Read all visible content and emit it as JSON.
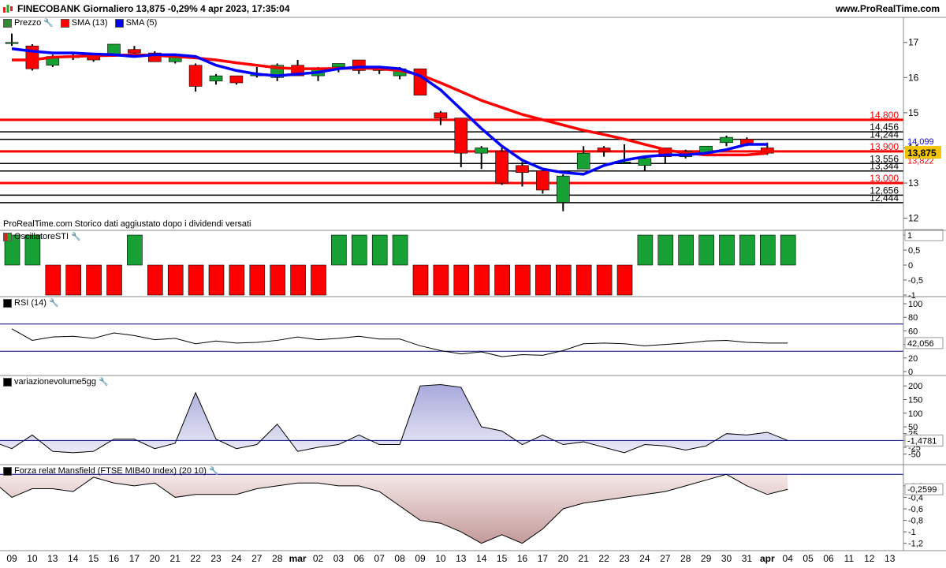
{
  "header": {
    "title": "FINECOBANK Giornaliero 13,875 -0,29% 4 apr 2023, 17:35:04",
    "brand": "www.ProRealTime.com"
  },
  "note": "ProRealTime.com Storico dati aggiustato dopo i dividendi versati",
  "legend_main": [
    {
      "label": "Prezzo",
      "color": "#2e8b2e"
    },
    {
      "label": "SMA (13)",
      "color": "#ff0000"
    },
    {
      "label": "SMA (5)",
      "color": "#0000ff"
    }
  ],
  "panels": {
    "osc": "OscillatoreSTI",
    "rsi": "RSI (14)",
    "vol": "variazionevolume5gg",
    "mans": "Forza relat Mansfield (FTSE MIB40 Index) (20 10)"
  },
  "colors": {
    "up": "#17a033",
    "down": "#ff0000",
    "sma13": "#ff0000",
    "sma5": "#0000ff",
    "badge": "#f5c400"
  },
  "chart_data": [
    {
      "type": "candlestick",
      "title": "FINECOBANK Giornaliero",
      "x_labels": [
        "09",
        "10",
        "13",
        "14",
        "15",
        "16",
        "17",
        "20",
        "21",
        "22",
        "23",
        "24",
        "27",
        "28",
        "mar",
        "02",
        "03",
        "06",
        "07",
        "08",
        "09",
        "10",
        "13",
        "14",
        "15",
        "16",
        "17",
        "20",
        "21",
        "22",
        "23",
        "24",
        "27",
        "28",
        "29",
        "30",
        "31",
        "apr",
        "04",
        "05",
        "06",
        "11",
        "12",
        "13"
      ],
      "ylim": [
        11.7,
        17.6
      ],
      "y_ticks": [
        12,
        13,
        14,
        15,
        16,
        17
      ],
      "candles": [
        {
          "o": 17.0,
          "h": 17.25,
          "l": 16.9,
          "c": 17.0
        },
        {
          "o": 16.9,
          "h": 16.95,
          "l": 16.2,
          "c": 16.25
        },
        {
          "o": 16.35,
          "h": 16.65,
          "l": 16.3,
          "c": 16.6
        },
        {
          "o": 16.6,
          "h": 16.7,
          "l": 16.5,
          "c": 16.6
        },
        {
          "o": 16.6,
          "h": 16.7,
          "l": 16.45,
          "c": 16.5
        },
        {
          "o": 16.65,
          "h": 16.95,
          "l": 16.6,
          "c": 16.95
        },
        {
          "o": 16.8,
          "h": 16.9,
          "l": 16.6,
          "c": 16.7
        },
        {
          "o": 16.7,
          "h": 16.75,
          "l": 16.45,
          "c": 16.45
        },
        {
          "o": 16.45,
          "h": 16.65,
          "l": 16.4,
          "c": 16.6
        },
        {
          "o": 16.35,
          "h": 16.4,
          "l": 15.6,
          "c": 15.75
        },
        {
          "o": 15.9,
          "h": 16.1,
          "l": 15.8,
          "c": 16.05
        },
        {
          "o": 16.05,
          "h": 16.05,
          "l": 15.8,
          "c": 15.85
        },
        {
          "o": 16.05,
          "h": 16.3,
          "l": 16.0,
          "c": 16.1
        },
        {
          "o": 16.0,
          "h": 16.4,
          "l": 15.9,
          "c": 16.35
        },
        {
          "o": 16.35,
          "h": 16.5,
          "l": 16.05,
          "c": 16.05
        },
        {
          "o": 16.05,
          "h": 16.3,
          "l": 15.9,
          "c": 16.25
        },
        {
          "o": 16.3,
          "h": 16.4,
          "l": 16.15,
          "c": 16.4
        },
        {
          "o": 16.5,
          "h": 16.5,
          "l": 16.1,
          "c": 16.2
        },
        {
          "o": 16.3,
          "h": 16.3,
          "l": 16.1,
          "c": 16.2
        },
        {
          "o": 16.05,
          "h": 16.3,
          "l": 15.95,
          "c": 16.25
        },
        {
          "o": 16.25,
          "h": 16.25,
          "l": 15.5,
          "c": 15.5
        },
        {
          "o": 15.0,
          "h": 15.05,
          "l": 14.65,
          "c": 14.85
        },
        {
          "o": 14.85,
          "h": 14.85,
          "l": 13.45,
          "c": 13.85
        },
        {
          "o": 13.85,
          "h": 14.05,
          "l": 13.4,
          "c": 14.0
        },
        {
          "o": 13.9,
          "h": 14.0,
          "l": 12.95,
          "c": 13.0
        },
        {
          "o": 13.5,
          "h": 13.6,
          "l": 12.9,
          "c": 13.3
        },
        {
          "o": 13.35,
          "h": 13.35,
          "l": 12.7,
          "c": 12.8
        },
        {
          "o": 12.45,
          "h": 13.25,
          "l": 12.2,
          "c": 13.2
        },
        {
          "o": 13.4,
          "h": 14.05,
          "l": 13.4,
          "c": 13.85
        },
        {
          "o": 14.0,
          "h": 14.05,
          "l": 13.75,
          "c": 13.9
        },
        {
          "o": 13.6,
          "h": 14.1,
          "l": 13.6,
          "c": 13.6
        },
        {
          "o": 13.5,
          "h": 13.75,
          "l": 13.35,
          "c": 13.7
        },
        {
          "o": 14.0,
          "h": 14.0,
          "l": 13.55,
          "c": 13.75
        },
        {
          "o": 13.75,
          "h": 13.95,
          "l": 13.7,
          "c": 13.9
        },
        {
          "o": 13.85,
          "h": 14.05,
          "l": 13.85,
          "c": 14.05
        },
        {
          "o": 14.15,
          "h": 14.35,
          "l": 14.05,
          "c": 14.3
        },
        {
          "o": 14.25,
          "h": 14.3,
          "l": 14.05,
          "c": 14.1
        },
        {
          "o": 14.0,
          "h": 14.15,
          "l": 13.8,
          "c": 13.85
        }
      ],
      "series": [
        {
          "name": "SMA (13)",
          "values": [
            16.5,
            16.5,
            16.58,
            16.6,
            16.62,
            16.63,
            16.65,
            16.63,
            16.6,
            16.56,
            16.5,
            16.42,
            16.35,
            16.28,
            16.25,
            16.25,
            16.26,
            16.27,
            16.25,
            16.2,
            16.08,
            15.85,
            15.6,
            15.35,
            15.15,
            14.95,
            14.8,
            14.65,
            14.5,
            14.38,
            14.25,
            14.1,
            13.95,
            13.85,
            13.8,
            13.8,
            13.8,
            13.85
          ]
        },
        {
          "name": "SMA (5)",
          "values": [
            16.82,
            16.75,
            16.7,
            16.7,
            16.67,
            16.65,
            16.6,
            16.65,
            16.65,
            16.6,
            16.35,
            16.2,
            16.1,
            16.05,
            16.1,
            16.15,
            16.25,
            16.3,
            16.3,
            16.25,
            16.05,
            15.65,
            15.1,
            14.55,
            14.05,
            13.65,
            13.4,
            13.3,
            13.25,
            13.5,
            13.65,
            13.75,
            13.8,
            13.8,
            13.85,
            13.95,
            14.1,
            14.1
          ]
        }
      ],
      "hlines": [
        {
          "value": 14.8,
          "label": "14,800",
          "color": "#ff0000"
        },
        {
          "value": 14.456,
          "label": "14,456",
          "color": "#000000"
        },
        {
          "value": 14.244,
          "label": "14,244",
          "color": "#000000"
        },
        {
          "value": 13.9,
          "label": "13,900",
          "color": "#ff0000"
        },
        {
          "value": 13.556,
          "label": "13,556",
          "color": "#000000"
        },
        {
          "value": 13.344,
          "label": "13,344",
          "color": "#000000"
        },
        {
          "value": 13.0,
          "label": "13,000",
          "color": "#ff0000"
        },
        {
          "value": 12.656,
          "label": "12,656",
          "color": "#000000"
        },
        {
          "value": 12.444,
          "label": "12,444",
          "color": "#000000"
        }
      ],
      "last_labels": [
        {
          "value": 14.099,
          "label": "14,099",
          "color": "#0000ff"
        },
        {
          "value": 13.822,
          "label": "13,822",
          "color": "#ff0000"
        },
        {
          "value": 13.875,
          "label": "13,875",
          "badge": true
        }
      ]
    },
    {
      "type": "bar",
      "title": "OscillatoreSTI",
      "ylim": [
        -1.2,
        1.2
      ],
      "y_ticks": [
        {
          "v": 1,
          "t": "1"
        },
        {
          "v": 0.5,
          "t": "0,5"
        },
        {
          "v": 0,
          "t": "0"
        },
        {
          "v": -0.5,
          "t": "-0,5"
        },
        {
          "v": -1,
          "t": "-1"
        }
      ],
      "values": [
        1,
        1,
        -1,
        -1,
        -1,
        -1,
        1,
        -1,
        -1,
        -1,
        -1,
        -1,
        -1,
        -1,
        -1,
        -1,
        1,
        1,
        1,
        1,
        -1,
        -1,
        -1,
        -1,
        -1,
        -1,
        -1,
        -1,
        -1,
        -1,
        -1,
        1,
        1,
        1,
        1,
        1,
        1,
        1,
        1
      ],
      "last_value_label": "1"
    },
    {
      "type": "line",
      "title": "RSI (14)",
      "ylim": [
        10,
        100
      ],
      "y_ticks": [
        {
          "v": 100,
          "t": "100"
        },
        {
          "v": 80,
          "t": "80"
        },
        {
          "v": 60,
          "t": "60"
        },
        {
          "v": 40,
          "t": "40"
        },
        {
          "v": 20,
          "t": "20"
        },
        {
          "v": 0,
          "t": "0"
        }
      ],
      "levels": [
        70,
        30
      ],
      "values": [
        63,
        46,
        51,
        52,
        49,
        57,
        53,
        47,
        49,
        41,
        45,
        42,
        43,
        46,
        51,
        47,
        49,
        52,
        48,
        48,
        38,
        31,
        26,
        29,
        22,
        25,
        24,
        31,
        41,
        42,
        41,
        38,
        40,
        42,
        45,
        46,
        43,
        42,
        42
      ],
      "last_value_label": "42,056"
    },
    {
      "type": "area",
      "title": "variazionevolume5gg",
      "ylim": [
        -80,
        215
      ],
      "y_ticks": [
        {
          "v": 200,
          "t": "200"
        },
        {
          "v": 150,
          "t": "150"
        },
        {
          "v": 100,
          "t": "100"
        },
        {
          "v": 50,
          "t": "50"
        },
        {
          "v": 25,
          "t": "25"
        },
        {
          "v": 0,
          "t": "0"
        },
        {
          "v": -25,
          "t": "-25"
        },
        {
          "v": -50,
          "t": "-50"
        }
      ],
      "values": [
        -2,
        -30,
        20,
        -40,
        -45,
        -40,
        5,
        5,
        -30,
        -10,
        175,
        5,
        -30,
        -15,
        60,
        -40,
        -25,
        -15,
        20,
        -15,
        -15,
        200,
        205,
        195,
        50,
        35,
        -15,
        20,
        -15,
        -5,
        -25,
        -45,
        -15,
        -20,
        -35,
        -20,
        25,
        20,
        30,
        0
      ],
      "last_value_label": "-1,4781"
    },
    {
      "type": "area",
      "title": "Forza relat Mansfield (FTSE MIB40 Index) (20 10)",
      "ylim": [
        -1.3,
        0.1
      ],
      "y_ticks": [
        {
          "v": -0.2,
          "t": "-0,2"
        },
        {
          "v": -0.4,
          "t": "-0,4"
        },
        {
          "v": -0.6,
          "t": "-0,6"
        },
        {
          "v": -0.8,
          "t": "-0,8"
        },
        {
          "v": -1,
          "t": "-1"
        },
        {
          "v": -1.2,
          "t": "-1,2"
        }
      ],
      "values": [
        -0.1,
        -0.4,
        -0.25,
        -0.25,
        -0.3,
        -0.05,
        -0.15,
        -0.2,
        -0.15,
        -0.4,
        -0.35,
        -0.35,
        -0.35,
        -0.25,
        -0.2,
        -0.15,
        -0.15,
        -0.2,
        -0.2,
        -0.3,
        -0.55,
        -0.8,
        -0.85,
        -1.0,
        -1.2,
        -1.05,
        -1.2,
        -0.95,
        -0.6,
        -0.5,
        -0.45,
        -0.4,
        -0.35,
        -0.3,
        -0.2,
        -0.1,
        0,
        -0.2,
        -0.35,
        -0.26
      ],
      "last_value_label": "-0,2599"
    }
  ]
}
